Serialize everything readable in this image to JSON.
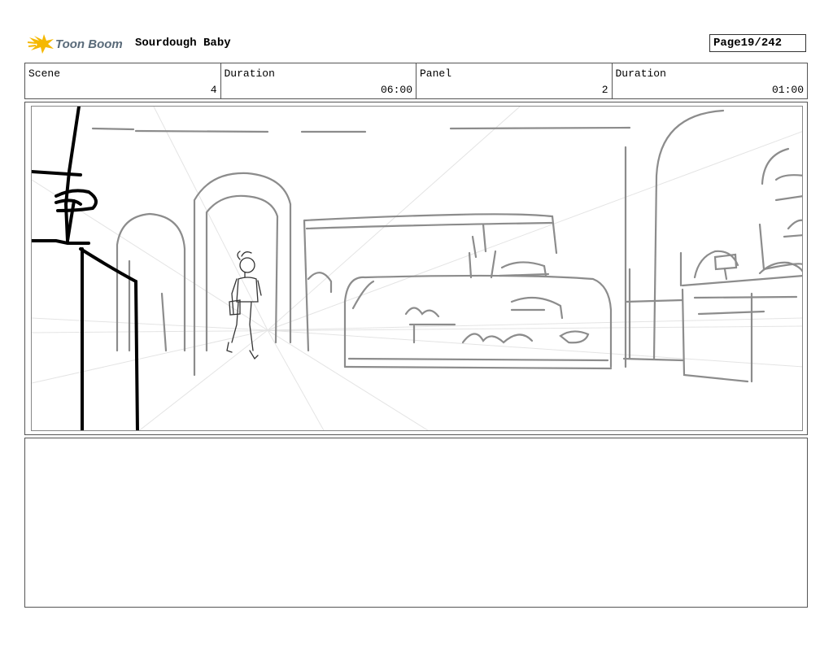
{
  "header": {
    "logo_text": "Toon Boom",
    "project_title": "Sourdough Baby",
    "page_label": "Page",
    "page_value": "19/242"
  },
  "info": {
    "scene_label": "Scene",
    "scene_value": "4",
    "scene_duration_label": "Duration",
    "scene_duration_value": "06:00",
    "panel_label": "Panel",
    "panel_value": "2",
    "panel_duration_label": "Duration",
    "panel_duration_value": "01:00"
  },
  "panel": {
    "sketch_icon": "storyboard-sketch-bakery-interior"
  },
  "notes": {
    "text": ""
  },
  "colors": {
    "logo_yellow": "#f5b800",
    "logo_text": "#5a6b7a",
    "sketch_gray": "#8a8a8a",
    "guide_lines": "#e2e2e2"
  }
}
